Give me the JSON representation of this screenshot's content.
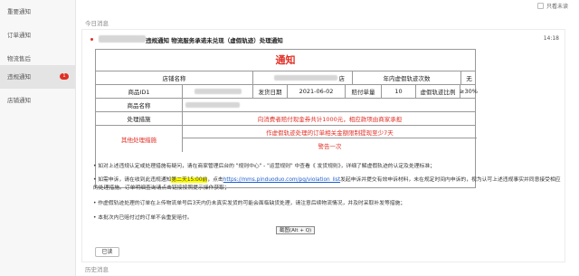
{
  "sidebar": {
    "items": [
      {
        "label": "重要通知",
        "active": false,
        "badge": ""
      },
      {
        "label": "订单通知",
        "active": false,
        "badge": ""
      },
      {
        "label": "物流售后",
        "active": false,
        "badge": ""
      },
      {
        "label": "违规通知",
        "active": true,
        "badge": "1"
      },
      {
        "label": "店铺通知",
        "active": false,
        "badge": ""
      }
    ]
  },
  "header": {
    "unread_only_label": "只看未读"
  },
  "sections": {
    "today": "今日消息",
    "history": "历史消息"
  },
  "message": {
    "title": "违规通知 物流服务承诺未兑现（虚假轨迹）处理通知",
    "time": "14:18",
    "notice": {
      "heading": "通知",
      "store_name_label": "店铺名称",
      "store_name_suffix": "店",
      "monthly_count_label": "年内虚假轨迹次数",
      "monthly_count_value": "无",
      "product_id_label": "商品ID1",
      "ship_date_label": "发货日期",
      "ship_date_value": "2021-06-02",
      "compensation_label": "赔付单量",
      "compensation_value": "10",
      "ratio_label": "虚假轨迹比例",
      "ratio_value": "≥30%",
      "product_name_label": "商品名称",
      "measures_label": "处理措施",
      "measures_value": "向消费者赔付现金券共计1000元，相应款项由商家承担",
      "other_measures_label": "其他处理措施",
      "other_measures_value_1": "作虚假轨迹处理的订单相关金额限制提现至少7天",
      "other_measures_value_2": "警告一次"
    },
    "bullets": {
      "b1": "• 如对上述违规认定或处理措施有疑问，请在商家管理后台的 \"规则中心\" - \"运营规则\" 中查看《          发货规则》，详细了解虚假轨迹的认定及处理标准；",
      "b2_prefix": "• 如需申诉，请在收到此违规通知",
      "b2_highlight": "第二天15:00前",
      "b2_mid": "，点击",
      "b2_link": "https://mms.pinduoduo.com/pg/violation_list",
      "b2_suffix": "发起申诉并提交有效申诉材料，未在规定时间内申诉的，视为认可上述违规事实并同意接受相应的处理措施。订单明细查询请点击链接按照提示操作获取；",
      "b3": "• 作虚假轨迹处理的订单在上传物流单号后3天内仍未真实发货的可能会面临缺货处理，请注意后续物流情况，并及时采取补发等措施；",
      "b4": "• 本批次内已赔付过的订单不会重复赔付。"
    },
    "tooltip": "截图(Alt + Q)",
    "read_button": "已读"
  }
}
